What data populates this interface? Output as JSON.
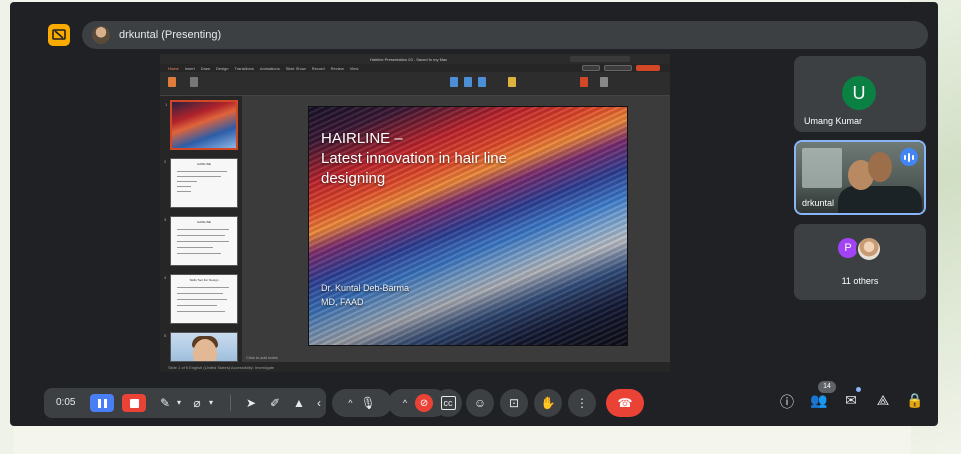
{
  "app": {
    "accent": "#8ab4f8",
    "background": "#202124",
    "tile_color": "#3c4043"
  },
  "top_bar": {
    "presenter_label": "drkuntal (Presenting)",
    "present_icon": "present-to-all-icon"
  },
  "shared_screen": {
    "window_title": "Hairline Presentation 03 - Saved to my Mac",
    "ribbon_tabs": [
      "Home",
      "Insert",
      "Draw",
      "Design",
      "Transitions",
      "Animations",
      "Slide Show",
      "Record",
      "Review",
      "View"
    ],
    "active_tab": "Home",
    "status_text": "Slide 1 of 6   English (United States)   Accessibility: Investigate",
    "notes_hint": "Click to add notes",
    "thumbnails": [
      {
        "num": "1",
        "type": "title-art"
      },
      {
        "num": "2",
        "type": "text",
        "title": "HAIRLINE"
      },
      {
        "num": "3",
        "type": "text",
        "title": "HAIRLINE"
      },
      {
        "num": "4",
        "type": "text",
        "title": "Skills Tool For Design"
      },
      {
        "num": "5",
        "type": "photo"
      }
    ],
    "slide": {
      "title": "HAIRLINE –\nLatest innovation in hair line\ndesigning",
      "author": "Dr. Kuntal Deb-Barma\nMD, FAAD"
    }
  },
  "participants": [
    {
      "name": "Umang Kumar",
      "initial": "U",
      "avatar_color": "#0b8043"
    },
    {
      "name": "drkuntal",
      "speaking": true
    },
    {
      "name": "11 others",
      "initial": "P",
      "avatar_color": "#a142f4"
    }
  ],
  "recording_bar": {
    "elapsed": "0:05",
    "pause_icon": "pause-icon",
    "stop_icon": "stop-icon"
  },
  "controls": {
    "mic_icon": "mic-icon",
    "camera_icon": "camera-off-icon",
    "captions_icon": "closed-captions-icon",
    "emoji_icon": "emoji-icon",
    "present_icon": "present-icon",
    "raise_hand_icon": "raise-hand-icon",
    "more_icon": "more-options-icon",
    "end_call_icon": "end-call-icon"
  },
  "right_controls": {
    "people_count": "14"
  }
}
